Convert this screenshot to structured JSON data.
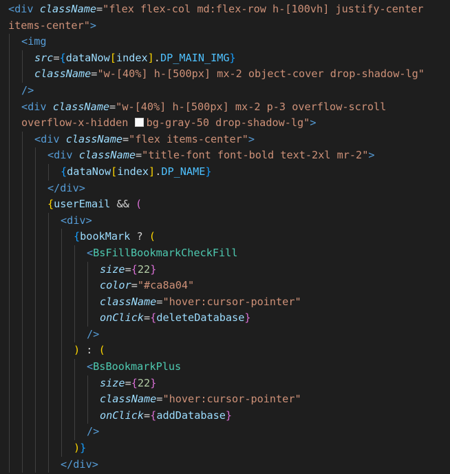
{
  "editor": {
    "theme_background": "#1e1e1e",
    "colors": {
      "tag": "#569cd6",
      "component": "#4ec9b0",
      "attribute": "#9cdcfe",
      "string": "#ce9178",
      "number": "#b5cea8",
      "bracket_gold": "#ffd700",
      "bracket_purple": "#da70d6",
      "bracket_blue": "#179fff"
    },
    "lines": [
      {
        "indent": 0,
        "tokens": [
          [
            "tag",
            "<div "
          ],
          [
            "attr",
            "className"
          ],
          [
            "punc",
            "="
          ],
          [
            "str",
            "\"flex flex-col md:flex-row h-[100vh] justify-center"
          ]
        ]
      },
      {
        "indent": 0,
        "tokens": [
          [
            "str",
            "items-center\""
          ],
          [
            "tag",
            ">"
          ]
        ]
      },
      {
        "indent": 1,
        "tokens": [
          [
            "tag",
            "<img"
          ]
        ]
      },
      {
        "indent": 2,
        "tokens": [
          [
            "attr",
            "src"
          ],
          [
            "punc",
            "="
          ],
          [
            "br3",
            "{"
          ],
          [
            "var",
            "dataNow"
          ],
          [
            "br1",
            "["
          ],
          [
            "var",
            "index"
          ],
          [
            "br1",
            "]"
          ],
          [
            "punc",
            "."
          ],
          [
            "prop",
            "DP_MAIN_IMG"
          ],
          [
            "br3",
            "}"
          ]
        ]
      },
      {
        "indent": 2,
        "tokens": [
          [
            "attr",
            "className"
          ],
          [
            "punc",
            "="
          ],
          [
            "str",
            "\"w-[40%] h-[500px] mx-2 object-cover drop-shadow-lg\""
          ]
        ]
      },
      {
        "indent": 1,
        "tokens": [
          [
            "tag",
            "/>"
          ]
        ]
      },
      {
        "indent": 1,
        "tokens": [
          [
            "tag",
            "<div "
          ],
          [
            "attr",
            "className"
          ],
          [
            "punc",
            "="
          ],
          [
            "str",
            "\"w-[40%] h-[500px] mx-2 p-3 overflow-scroll"
          ]
        ]
      },
      {
        "indent": 1,
        "tokens": [
          [
            "str",
            "overflow-x-hidden "
          ],
          [
            "swatch",
            ""
          ],
          [
            "str",
            "bg-gray-50 drop-shadow-lg\""
          ],
          [
            "tag",
            ">"
          ]
        ]
      },
      {
        "indent": 2,
        "tokens": [
          [
            "tag",
            "<div "
          ],
          [
            "attr",
            "className"
          ],
          [
            "punc",
            "="
          ],
          [
            "str",
            "\"flex items-center\""
          ],
          [
            "tag",
            ">"
          ]
        ]
      },
      {
        "indent": 3,
        "tokens": [
          [
            "tag",
            "<div "
          ],
          [
            "attr",
            "className"
          ],
          [
            "punc",
            "="
          ],
          [
            "str",
            "\"title-font font-bold text-2xl mr-2\""
          ],
          [
            "tag",
            ">"
          ]
        ]
      },
      {
        "indent": 4,
        "tokens": [
          [
            "br3",
            "{"
          ],
          [
            "var",
            "dataNow"
          ],
          [
            "br1",
            "["
          ],
          [
            "var",
            "index"
          ],
          [
            "br1",
            "]"
          ],
          [
            "punc",
            "."
          ],
          [
            "prop",
            "DP_NAME"
          ],
          [
            "br3",
            "}"
          ]
        ]
      },
      {
        "indent": 3,
        "tokens": [
          [
            "tag",
            "</div>"
          ]
        ]
      },
      {
        "indent": 3,
        "tokens": [
          [
            "br1",
            "{"
          ],
          [
            "var",
            "userEmail"
          ],
          [
            "op",
            " && "
          ],
          [
            "br2",
            "("
          ]
        ]
      },
      {
        "indent": 4,
        "tokens": [
          [
            "tag",
            "<div>"
          ]
        ]
      },
      {
        "indent": 5,
        "tokens": [
          [
            "br3",
            "{"
          ],
          [
            "var",
            "bookMark"
          ],
          [
            "op",
            " ? "
          ],
          [
            "br1",
            "("
          ]
        ]
      },
      {
        "indent": 6,
        "tokens": [
          [
            "tag",
            "<"
          ],
          [
            "comp",
            "BsFillBookmarkCheckFill"
          ]
        ]
      },
      {
        "indent": 7,
        "tokens": [
          [
            "attr",
            "size"
          ],
          [
            "punc",
            "="
          ],
          [
            "br2",
            "{"
          ],
          [
            "num",
            "22"
          ],
          [
            "br2",
            "}"
          ]
        ]
      },
      {
        "indent": 7,
        "tokens": [
          [
            "attr",
            "color"
          ],
          [
            "punc",
            "="
          ],
          [
            "str",
            "\"#ca8a04\""
          ]
        ]
      },
      {
        "indent": 7,
        "tokens": [
          [
            "attr",
            "className"
          ],
          [
            "punc",
            "="
          ],
          [
            "str",
            "\"hover:cursor-pointer\""
          ]
        ]
      },
      {
        "indent": 7,
        "tokens": [
          [
            "attr",
            "onClick"
          ],
          [
            "punc",
            "="
          ],
          [
            "br2",
            "{"
          ],
          [
            "var",
            "deleteDatabase"
          ],
          [
            "br2",
            "}"
          ]
        ]
      },
      {
        "indent": 6,
        "tokens": [
          [
            "tag",
            "/>"
          ]
        ]
      },
      {
        "indent": 5,
        "tokens": [
          [
            "br1",
            ")"
          ],
          [
            "op",
            " : "
          ],
          [
            "br1",
            "("
          ]
        ]
      },
      {
        "indent": 6,
        "tokens": [
          [
            "tag",
            "<"
          ],
          [
            "comp",
            "BsBookmarkPlus"
          ]
        ]
      },
      {
        "indent": 7,
        "tokens": [
          [
            "attr",
            "size"
          ],
          [
            "punc",
            "="
          ],
          [
            "br2",
            "{"
          ],
          [
            "num",
            "22"
          ],
          [
            "br2",
            "}"
          ]
        ]
      },
      {
        "indent": 7,
        "tokens": [
          [
            "attr",
            "className"
          ],
          [
            "punc",
            "="
          ],
          [
            "str",
            "\"hover:cursor-pointer\""
          ]
        ]
      },
      {
        "indent": 7,
        "tokens": [
          [
            "attr",
            "onClick"
          ],
          [
            "punc",
            "="
          ],
          [
            "br2",
            "{"
          ],
          [
            "var",
            "addDatabase"
          ],
          [
            "br2",
            "}"
          ]
        ]
      },
      {
        "indent": 6,
        "tokens": [
          [
            "tag",
            "/>"
          ]
        ]
      },
      {
        "indent": 5,
        "tokens": [
          [
            "br1",
            ")"
          ],
          [
            "br3",
            "}"
          ]
        ]
      },
      {
        "indent": 4,
        "tokens": [
          [
            "tag",
            "</div>"
          ]
        ]
      }
    ]
  }
}
